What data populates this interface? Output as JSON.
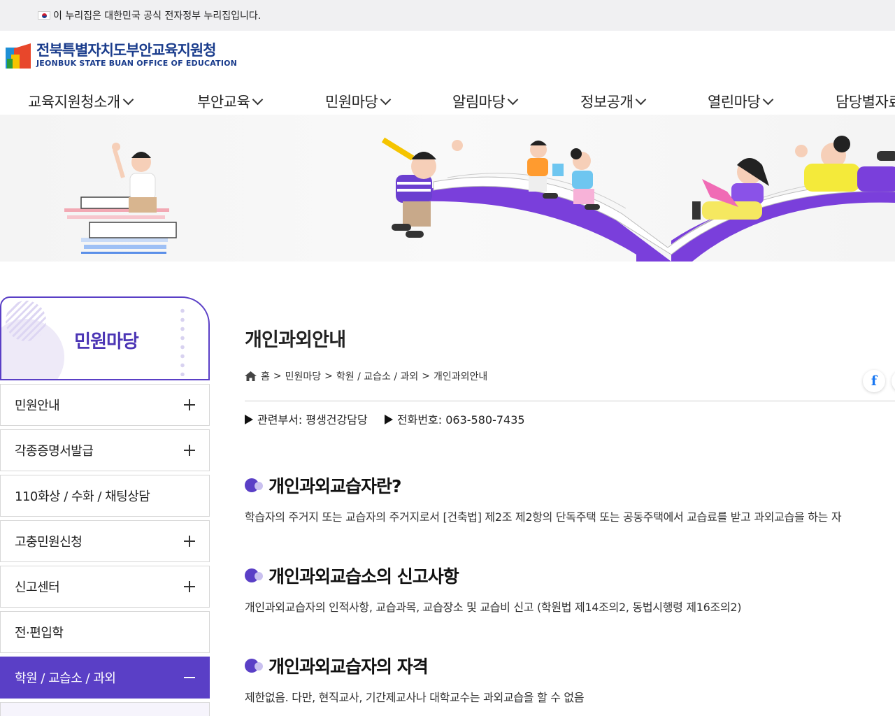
{
  "gov_bar": {
    "text": "이 누리집은 대한민국 공식 전자정부 누리집입니다."
  },
  "logo": {
    "name_ko": "전북특별자치도부안교육지원청",
    "name_en": "JEONBUK STATE BUAN OFFICE OF EDUCATION"
  },
  "gnb": [
    {
      "label": "교육지원청소개"
    },
    {
      "label": "부안교육"
    },
    {
      "label": "민원마당"
    },
    {
      "label": "알림마당"
    },
    {
      "label": "정보공개"
    },
    {
      "label": "열린마당"
    },
    {
      "label": "담당별자료"
    }
  ],
  "lnb": {
    "title": "민원마당",
    "items": [
      {
        "label": "민원안내",
        "expand": "plus"
      },
      {
        "label": "각종증명서발급",
        "expand": "plus"
      },
      {
        "label": "110화상 / 수화 / 채팅상담",
        "expand": "none"
      },
      {
        "label": "고충민원신청",
        "expand": "plus"
      },
      {
        "label": "신고센터",
        "expand": "plus"
      },
      {
        "label": "전·편입학",
        "expand": "none"
      },
      {
        "label": "학원 / 교습소 / 과외",
        "expand": "minus",
        "active": true
      }
    ]
  },
  "content": {
    "title": "개인과외안내",
    "breadcrumb": [
      "홈",
      "민원마당",
      "학원 / 교습소 / 과외",
      "개인과외안내"
    ],
    "breadcrumb_sep": ">",
    "share_label": "f",
    "dept_label": "관련부서: 평생건강담당",
    "phone_label": "전화번호: 063-580-7435",
    "sections": [
      {
        "title": "개인과외교습자란?",
        "text": "학습자의 주거지 또는 교습자의 주거지로서 [건축법] 제2조 제2항의 단독주택 또는 공동주택에서 교습료를 받고 과외교습을 하는 자"
      },
      {
        "title": "개인과외교습소의 신고사항",
        "text": "개인과외교습자의 인적사항, 교습과목, 교습장소 및 교습비 신고 (학원법 제14조의2, 동법시행령 제16조의2)"
      },
      {
        "title": "개인과외교습자의 자격",
        "text": "제한없음. 다만, 현직교사, 기간제교사나 대학교수는 과외교습을 할 수 없음"
      }
    ]
  },
  "colors": {
    "primary": "#5a3fc6",
    "logo_text": "#1a3c8c",
    "gov_bar_bg": "#f0f0f2"
  }
}
